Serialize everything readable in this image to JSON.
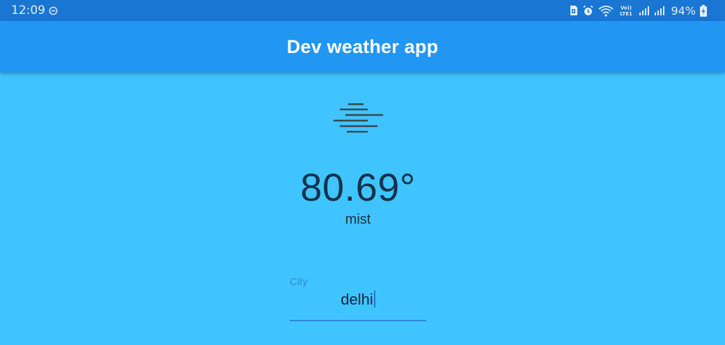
{
  "status_bar": {
    "time": "12:09",
    "battery": "94%",
    "icons": [
      "do-not-disturb-icon",
      "sim-icon",
      "alarm-icon",
      "wifi-icon",
      "volte-icon",
      "signal-icon",
      "signal-icon-2",
      "battery-charging-icon"
    ],
    "volte_text": "Vo)) LTE1"
  },
  "app_bar": {
    "title": "Dev weather app"
  },
  "weather": {
    "icon": "mist-icon",
    "temperature": "80.69°",
    "condition": "mist"
  },
  "city_input": {
    "label": "City",
    "value": "delhi"
  },
  "colors": {
    "status_bar": "#1976d2",
    "app_bar": "#2196f3",
    "background": "#40c4ff",
    "input_accent": "#2f86dd"
  }
}
